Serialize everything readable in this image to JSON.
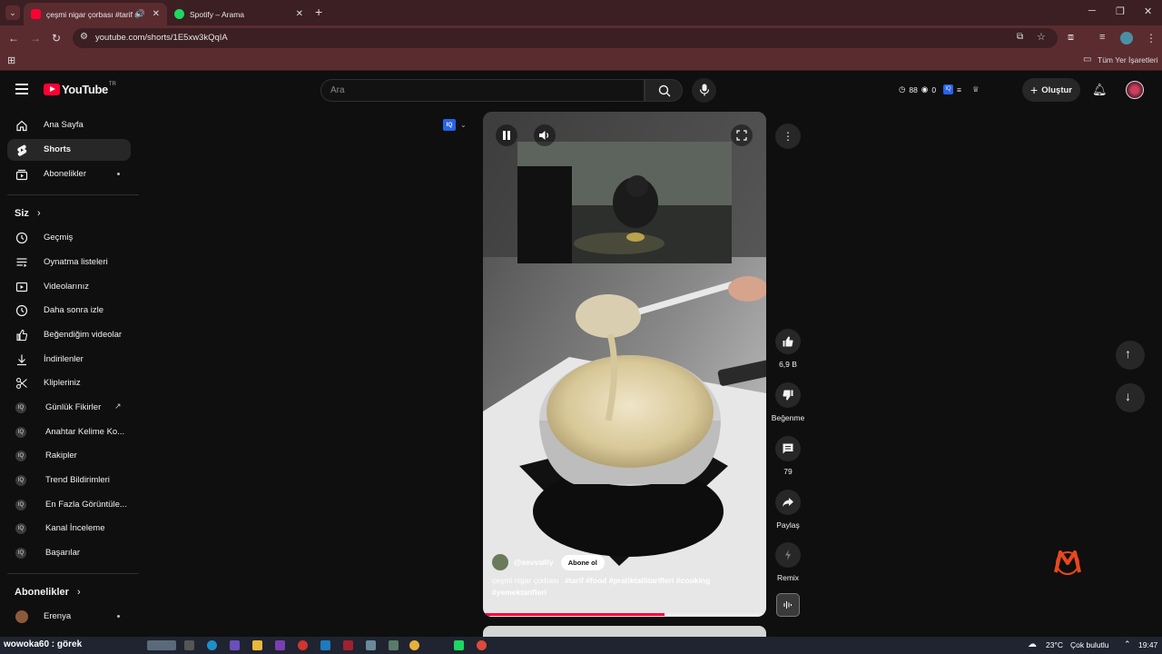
{
  "browser": {
    "tabs": [
      {
        "title": "çeşmi nigar çorbası #tarif #",
        "active": true
      },
      {
        "title": "Spotify – Arama",
        "active": false
      }
    ],
    "url": "youtube.com/shorts/1E5xw3kQqIA",
    "bookmarks_label": "Tüm Yer İşaretleri"
  },
  "youtube": {
    "logo_text": "YouTube",
    "logo_superscript": "TR",
    "search_placeholder": "Ara",
    "header_stats": {
      "views": "88",
      "watching": "0"
    },
    "create_label": "Oluştur",
    "sidebar": {
      "main": [
        {
          "label": "Ana Sayfa",
          "icon": "home-icon"
        },
        {
          "label": "Shorts",
          "icon": "shorts-icon",
          "active": true
        },
        {
          "label": "Abonelikler",
          "icon": "subscriptions-icon",
          "dot": true
        }
      ],
      "you_heading": "Siz",
      "you": [
        {
          "label": "Geçmiş",
          "icon": "history-icon"
        },
        {
          "label": "Oynatma listeleri",
          "icon": "playlists-icon"
        },
        {
          "label": "Videolarınız",
          "icon": "your-videos-icon"
        },
        {
          "label": "Daha sonra izle",
          "icon": "watch-later-icon"
        },
        {
          "label": "Beğendiğim videolar",
          "icon": "liked-videos-icon"
        },
        {
          "label": "İndirilenler",
          "icon": "downloads-icon"
        },
        {
          "label": "Klipleriniz",
          "icon": "clips-icon"
        }
      ],
      "tools": [
        {
          "label": "Günlük Fikirler",
          "external": true
        },
        {
          "label": "Anahtar Kelime Ko..."
        },
        {
          "label": "Rakipler"
        },
        {
          "label": "Trend Bildirimleri"
        },
        {
          "label": "En Fazla Görüntüle..."
        },
        {
          "label": "Kanal İnceleme"
        },
        {
          "label": "Başarılar"
        }
      ],
      "subs_heading": "Abonelikler",
      "subs": [
        {
          "label": "Erenya",
          "dot": true
        }
      ]
    },
    "short": {
      "channel": "@sevvallly",
      "subscribe_label": "Abone ol",
      "caption_text": "çeşmi nigar çorbası",
      "hashtags_line1": "#tarif #food #pratiktatlitarifleri #cooking",
      "hashtags_line2": "#yemektarifleri",
      "progress_fraction": 0.64,
      "iq_badge": "IQ"
    },
    "actions": {
      "likes": "6,9 B",
      "dislike_label": "Beğenme",
      "comments": "79",
      "share_label": "Paylaş",
      "remix_label": "Remix"
    }
  },
  "taskbar": {
    "user_label": "wowoka60 : görek",
    "weather": "23°C",
    "weather_desc": "Çok bulutlu",
    "time": "19:47"
  },
  "colors": {
    "yt_red": "#ff0033",
    "tab_bar": "#3c1f22",
    "toolbar": "#5a2c30"
  }
}
